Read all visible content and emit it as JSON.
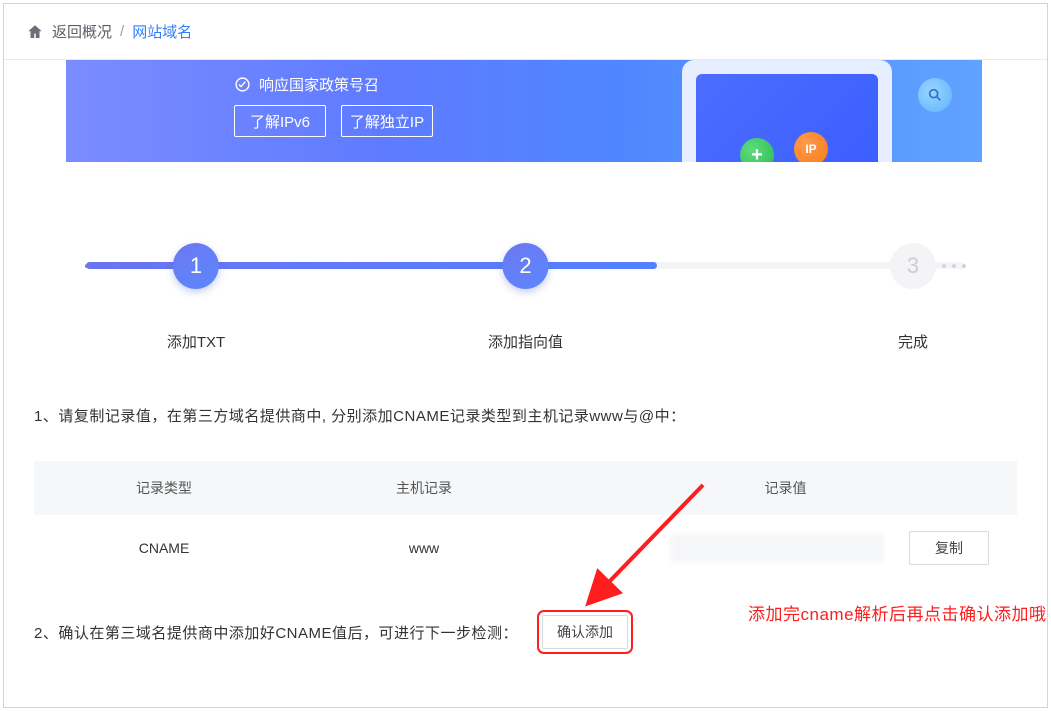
{
  "breadcrumb": {
    "back": "返回概况",
    "here": "网站域名",
    "sep": "/"
  },
  "banner": {
    "tagline": "响应国家政策号召",
    "btn_ipv6": "了解IPv6",
    "btn_ip": "了解独立IP"
  },
  "steps": {
    "s1_num": "1",
    "s1_label": "添加TXT",
    "s2_num": "2",
    "s2_label": "添加指向值",
    "s3_num": "3",
    "s3_label": "完成"
  },
  "instructions": {
    "line1": "1、请复制记录值，在第三方域名提供商中, 分别添加CNAME记录类型到主机记录www与@中：",
    "line2": "2、确认在第三域名提供商中添加好CNAME值后，可进行下一步检测："
  },
  "table": {
    "head_type": "记录类型",
    "head_host": "主机记录",
    "head_value": "记录值",
    "row1_type": "CNAME",
    "row1_host": "www",
    "copy_label": "复制"
  },
  "actions": {
    "confirm_add": "确认添加"
  },
  "annotation": {
    "text": "添加完cname解析后再点击确认添加哦"
  }
}
